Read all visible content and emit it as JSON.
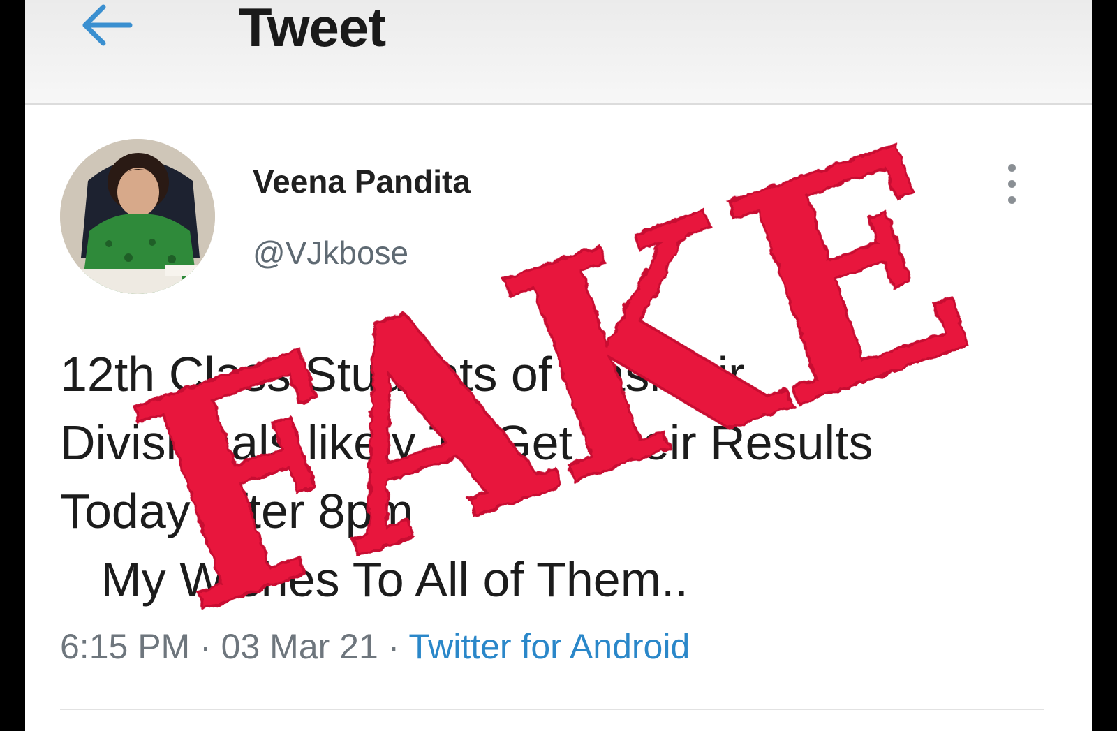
{
  "header": {
    "title": "Tweet",
    "back_icon": "arrow-left-icon"
  },
  "tweet": {
    "display_name": "Veena Pandita",
    "handle": "@VJkbose",
    "body_lines": [
      "12th Class Students of Kashmir",
      "Divisionals likely To Get Their Results",
      "Today After 8pm",
      "   My Wishes To All of Them.."
    ],
    "time": "6:15 PM",
    "date": "03 Mar 21",
    "separator": " · ",
    "source": "Twitter for Android",
    "more_icon": "more-vertical-icon"
  },
  "stamp": {
    "text": "FAKE",
    "color": "#e8143c"
  },
  "colors": {
    "link": "#2a87c9",
    "back_arrow": "#3a8fd0"
  }
}
